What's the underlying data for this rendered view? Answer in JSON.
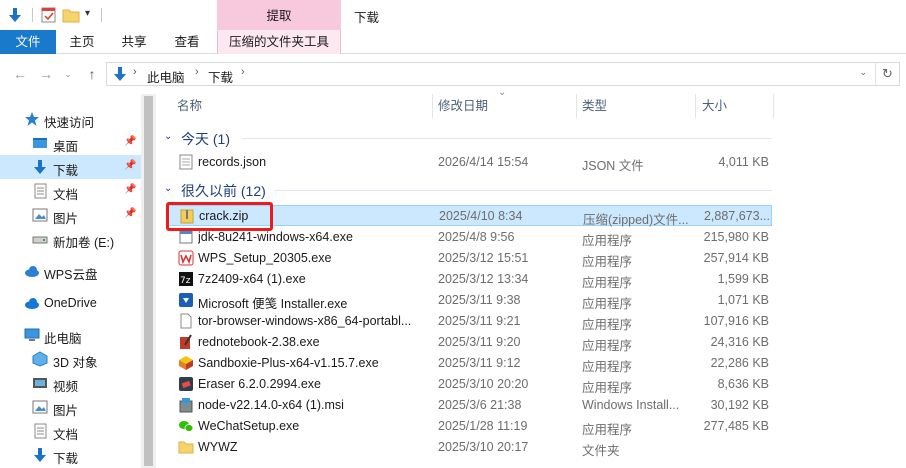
{
  "titlebar": {
    "context_tab": "提取",
    "window_title": "下载"
  },
  "ribbon": {
    "tabs": [
      "文件",
      "主页",
      "共享",
      "查看",
      "压缩的文件夹工具"
    ]
  },
  "address": {
    "crumbs": [
      "此电脑",
      "下载"
    ]
  },
  "sidebar": {
    "items": [
      {
        "label": "快速访问",
        "icon": "star-icon",
        "pinned": false
      },
      {
        "label": "桌面",
        "icon": "desktop-folder-icon",
        "pinned": true
      },
      {
        "label": "下载",
        "icon": "download-arrow-icon",
        "pinned": true
      },
      {
        "label": "文档",
        "icon": "documents-icon",
        "pinned": true
      },
      {
        "label": "图片",
        "icon": "pictures-icon",
        "pinned": true
      },
      {
        "label": "新加卷 (E:)",
        "icon": "drive-icon",
        "pinned": false
      },
      {
        "label": "WPS云盘",
        "icon": "cloud-icon",
        "pinned": false
      },
      {
        "label": "OneDrive",
        "icon": "onedrive-cloud-icon",
        "pinned": false
      },
      {
        "label": "此电脑",
        "icon": "computer-icon",
        "pinned": false
      },
      {
        "label": "3D 对象",
        "icon": "3d-objects-icon",
        "pinned": false
      },
      {
        "label": "视频",
        "icon": "videos-icon",
        "pinned": false
      },
      {
        "label": "图片",
        "icon": "pictures-icon",
        "pinned": false
      },
      {
        "label": "文档",
        "icon": "documents-icon",
        "pinned": false
      },
      {
        "label": "下载",
        "icon": "download-arrow-icon",
        "pinned": false
      }
    ]
  },
  "columns": {
    "name": "名称",
    "date": "修改日期",
    "type": "类型",
    "size": "大小"
  },
  "groups": [
    {
      "label": "今天 (1)"
    },
    {
      "label": "很久以前 (12)"
    }
  ],
  "files": [
    {
      "name": "records.json",
      "date": "2026/4/14 15:54",
      "type": "JSON 文件",
      "size": "4,011 KB",
      "icon": "json-file-icon"
    },
    {
      "name": "crack.zip",
      "date": "2025/4/10 8:34",
      "type": "压缩(zipped)文件...",
      "size": "2,887,673...",
      "icon": "zip-folder-icon"
    },
    {
      "name": "jdk-8u241-windows-x64.exe",
      "date": "2025/4/8 9:56",
      "type": "应用程序",
      "size": "215,980 KB",
      "icon": "exe-file-icon"
    },
    {
      "name": "WPS_Setup_20305.exe",
      "date": "2025/3/12 15:51",
      "type": "应用程序",
      "size": "257,914 KB",
      "icon": "wps-installer-icon"
    },
    {
      "name": "7z2409-x64 (1).exe",
      "date": "2025/3/12 13:34",
      "type": "应用程序",
      "size": "1,599 KB",
      "icon": "7zip-icon"
    },
    {
      "name": "Microsoft 便笺 Installer.exe",
      "date": "2025/3/11 9:38",
      "type": "应用程序",
      "size": "1,071 KB",
      "icon": "installer-download-icon"
    },
    {
      "name": "tor-browser-windows-x86_64-portabl...",
      "date": "2025/3/11 9:21",
      "type": "应用程序",
      "size": "107,916 KB",
      "icon": "blank-file-icon"
    },
    {
      "name": "rednotebook-2.38.exe",
      "date": "2025/3/11 9:20",
      "type": "应用程序",
      "size": "24,316 KB",
      "icon": "notebook-pen-icon"
    },
    {
      "name": "Sandboxie-Plus-x64-v1.15.7.exe",
      "date": "2025/3/11 9:12",
      "type": "应用程序",
      "size": "22,286 KB",
      "icon": "sandboxie-icon"
    },
    {
      "name": "Eraser 6.2.0.2994.exe",
      "date": "2025/3/10 20:20",
      "type": "应用程序",
      "size": "8,636 KB",
      "icon": "eraser-icon"
    },
    {
      "name": "node-v22.14.0-x64 (1).msi",
      "date": "2025/3/6 21:38",
      "type": "Windows Install...",
      "size": "30,192 KB",
      "icon": "msi-package-icon"
    },
    {
      "name": "WeChatSetup.exe",
      "date": "2025/1/28 11:19",
      "type": "应用程序",
      "size": "277,485 KB",
      "icon": "wechat-icon"
    },
    {
      "name": "WYWZ",
      "date": "2025/3/10 20:17",
      "type": "文件夹",
      "size": "",
      "icon": "folder-icon"
    }
  ],
  "colors": {
    "accent": "#1979ca",
    "selection": "#cce8ff",
    "context_tab": "#f8c9dd",
    "highlight_box": "#ee1b1b",
    "group_text": "#1e3f7a"
  }
}
